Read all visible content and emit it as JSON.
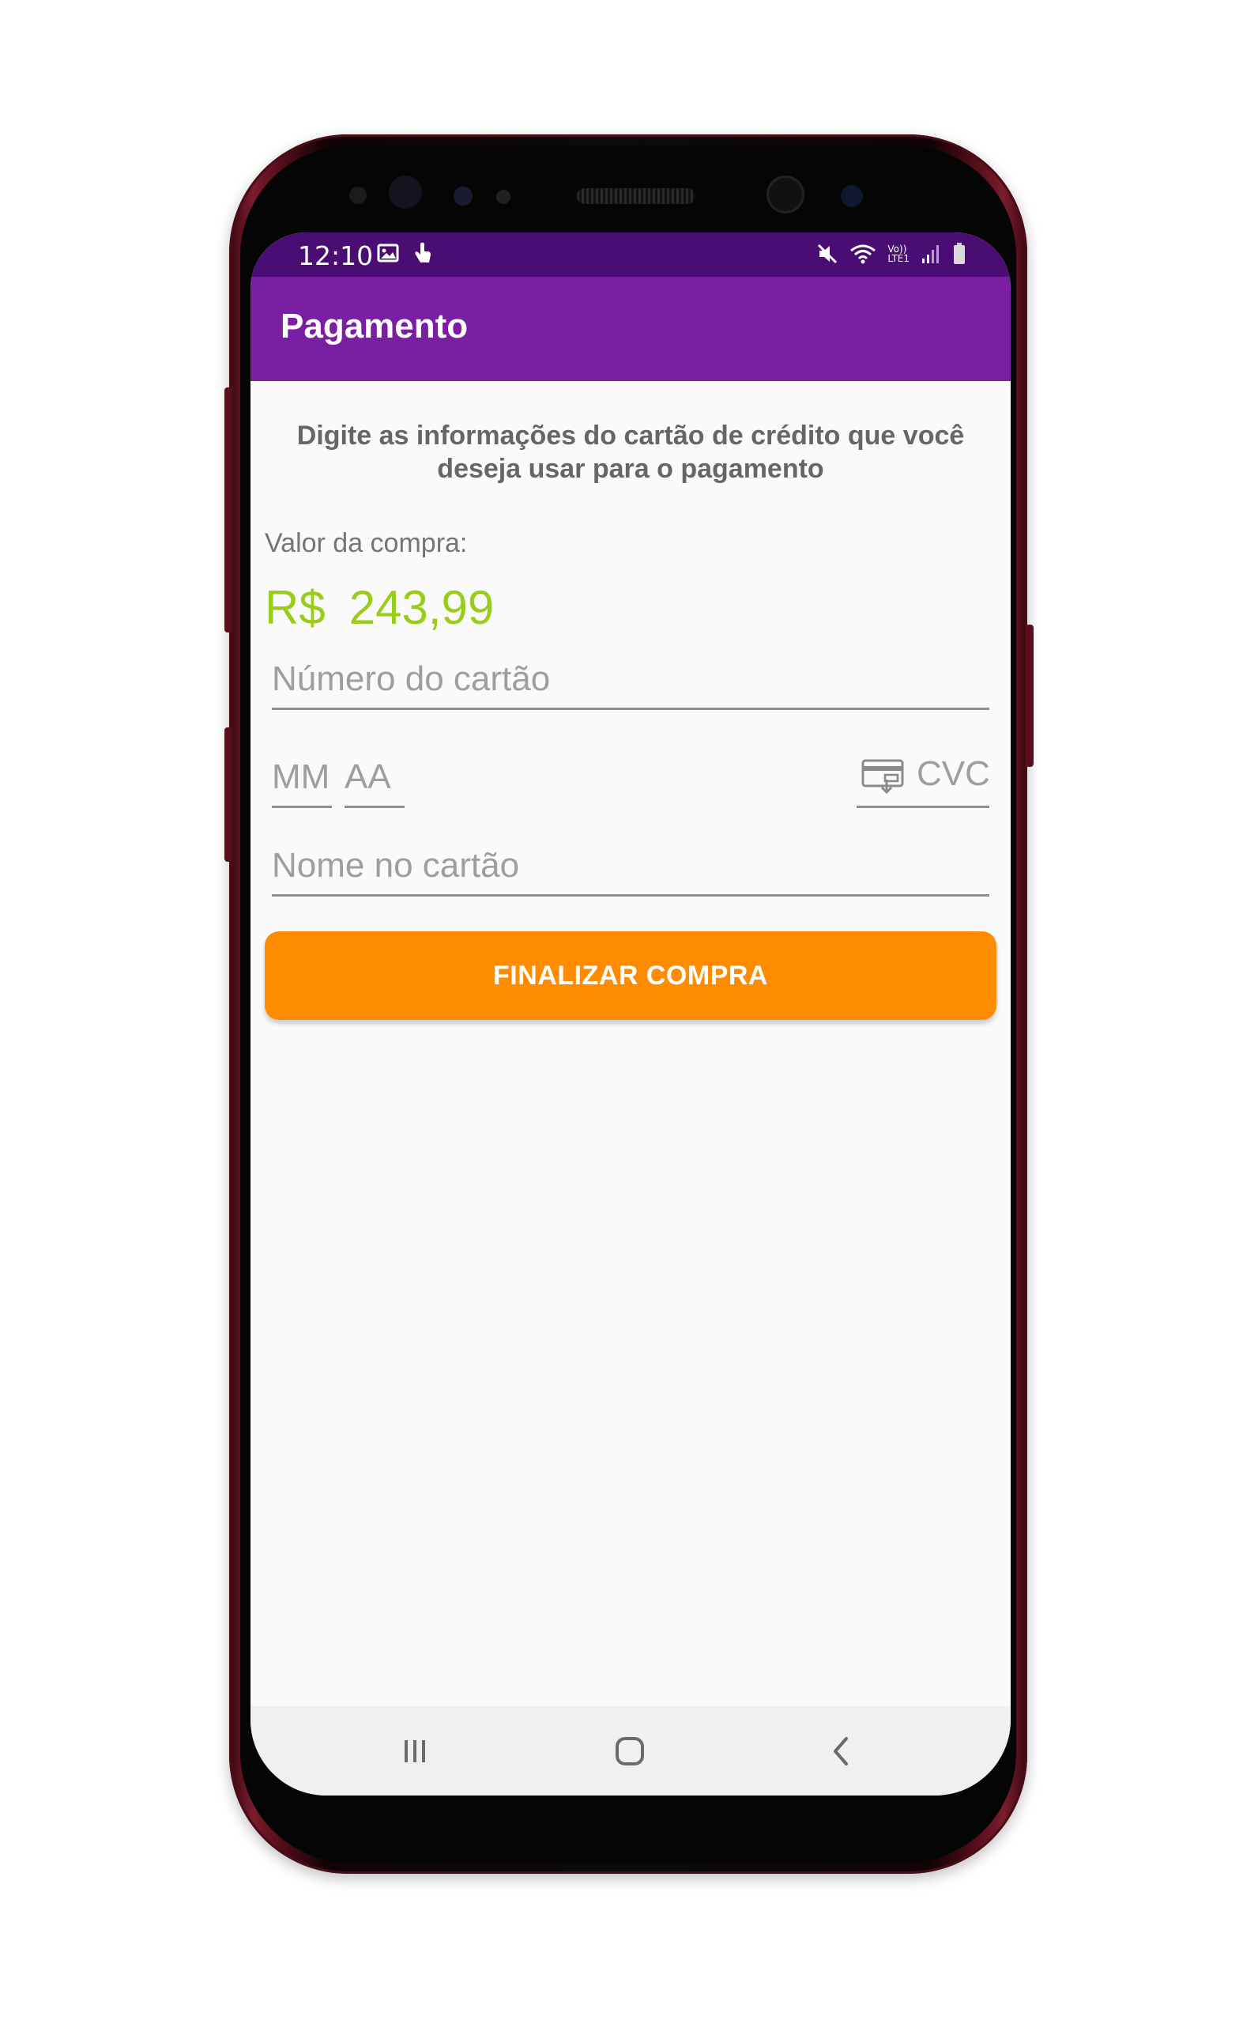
{
  "status_bar": {
    "time": "12:10",
    "left_icons": [
      "image-icon",
      "touch-icon"
    ],
    "right_icons": [
      "mute-icon",
      "wifi-icon",
      "volte-icon",
      "signal-icon",
      "battery-icon"
    ],
    "volte_text_top": "Vo))",
    "volte_text_bottom": "LTE1"
  },
  "app_bar": {
    "title": "Pagamento",
    "color": "#7b1fa2",
    "status_color": "#4a0d73"
  },
  "main": {
    "instructions": "Digite as informações do cartão de crédito que você deseja usar para o pagamento",
    "amount_label": "Valor da compra:",
    "amount_currency": "R$",
    "amount_value": "243,99",
    "amount_color": "#9acd1a"
  },
  "form": {
    "card_number_placeholder": "Número do cartão",
    "month_placeholder": "MM",
    "year_placeholder": "AA",
    "cvc_placeholder": "CVC",
    "name_placeholder": "Nome no cartão",
    "submit_label": "FINALIZAR COMPRA",
    "submit_color": "#ff8c00"
  },
  "nav": {
    "icons": [
      "recents-icon",
      "home-icon",
      "back-icon"
    ]
  }
}
